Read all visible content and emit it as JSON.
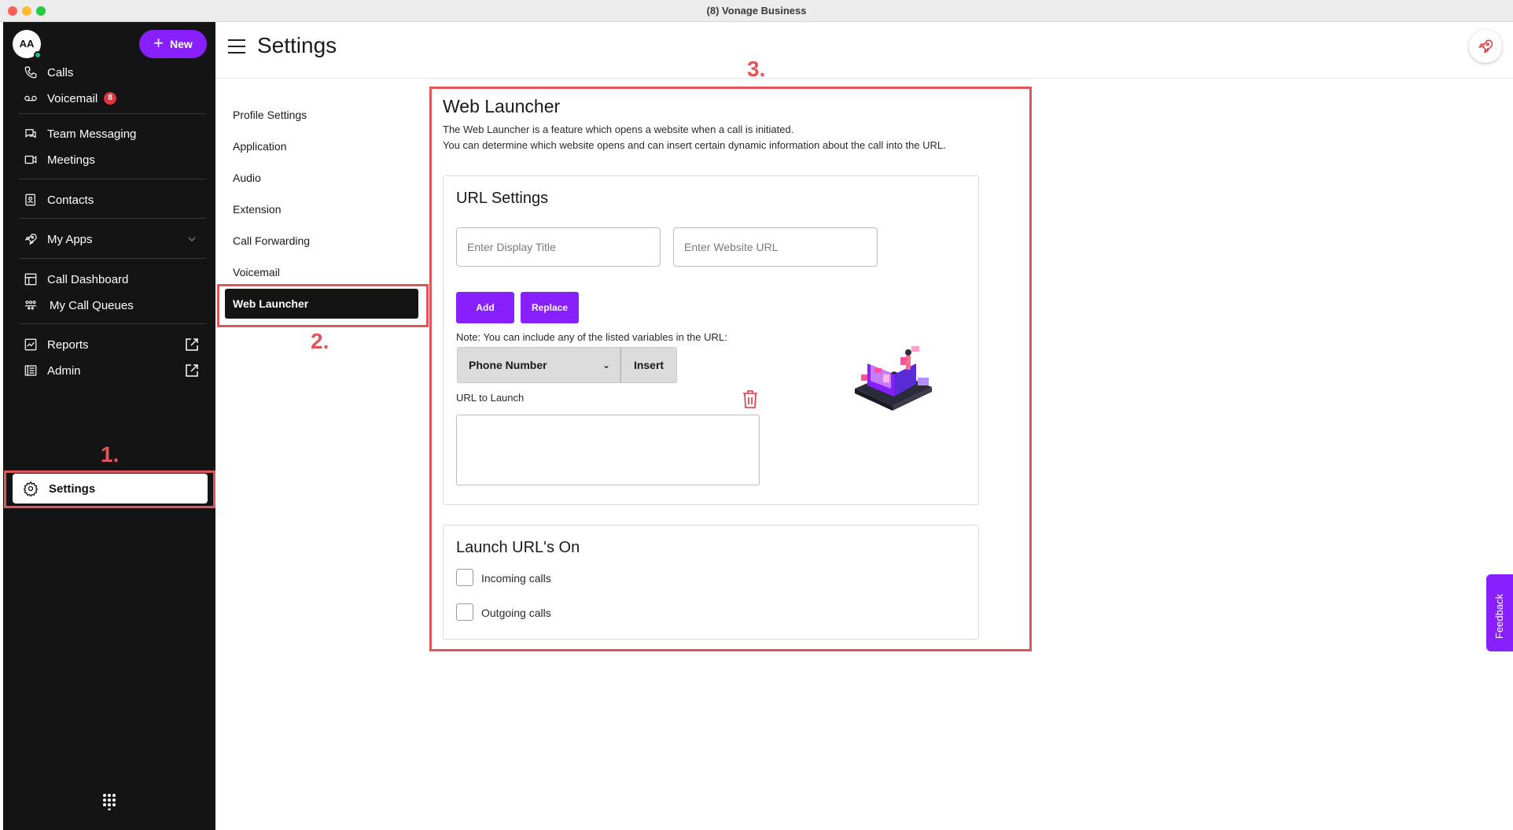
{
  "window": {
    "title": "(8) Vonage Business"
  },
  "colors": {
    "accent": "#871fff",
    "sidebar_bg": "#141414",
    "annotation": "#e0565b",
    "badge": "#e0343e"
  },
  "sidebar": {
    "avatar_initials": "AA",
    "new_button": "New",
    "items": [
      {
        "label": "Calls",
        "icon": "phone-icon"
      },
      {
        "label": "Voicemail",
        "icon": "voicemail-icon",
        "badge": "8"
      },
      {
        "label": "Team Messaging",
        "icon": "chat-icon"
      },
      {
        "label": "Meetings",
        "icon": "video-icon"
      },
      {
        "label": "Contacts",
        "icon": "contacts-icon"
      },
      {
        "label": "My Apps",
        "icon": "rocket-icon"
      },
      {
        "label": "Call Dashboard",
        "icon": "dashboard-icon"
      },
      {
        "label": "My Call Queues",
        "icon": "queues-icon"
      },
      {
        "label": "Reports",
        "icon": "chart-icon"
      },
      {
        "label": "Admin",
        "icon": "admin-icon"
      },
      {
        "label": "Settings",
        "icon": "gear-icon"
      }
    ]
  },
  "annotations": {
    "one": "1.",
    "two": "2.",
    "three": "3."
  },
  "header": {
    "title": "Settings"
  },
  "settings_menu": {
    "items": [
      "Profile Settings",
      "Application",
      "Audio",
      "Extension",
      "Call Forwarding",
      "Voicemail",
      "Web Launcher"
    ],
    "active": "Web Launcher"
  },
  "web_launcher": {
    "title": "Web Launcher",
    "description_1": "The Web Launcher is a feature which opens a website when a call is initiated.",
    "description_2": "You can determine which website opens and can insert certain dynamic information about the call into the URL.",
    "url_settings": {
      "title": "URL Settings",
      "display_title_placeholder": "Enter Display Title",
      "website_url_placeholder": "Enter Website URL",
      "add_label": "Add",
      "replace_label": "Replace",
      "note": "Note: You can include any of the listed variables in the URL:",
      "variable_selected": "Phone Number",
      "insert_label": "Insert",
      "url_to_launch_label": "URL to Launch"
    },
    "launch_on": {
      "title": "Launch URL's On",
      "incoming": "Incoming calls",
      "outgoing": "Outgoing calls"
    }
  },
  "feedback_label": "Feedback"
}
